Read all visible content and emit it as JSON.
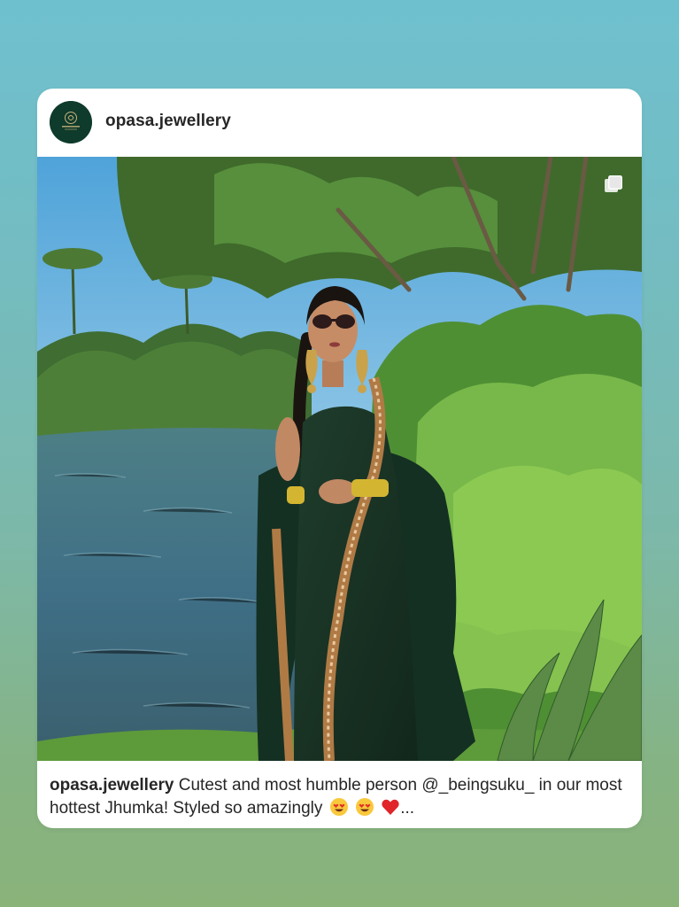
{
  "post": {
    "username": "opasa.jewellery",
    "caption_user": "opasa.jewellery",
    "caption_text": "Cutest and most humble person @_beingsuku_ in our most hottest Jhumka! Styled so amazingly",
    "caption_ellipsis": "...",
    "caption_emojis": [
      "smiling-face-with-heart-eyes",
      "smiling-face-with-heart-eyes",
      "red-heart"
    ],
    "media_icon": "multiple-media-icon"
  },
  "colors": {
    "avatar_bg": "#0f3b2c",
    "text": "#262626",
    "card_bg": "#ffffff"
  }
}
